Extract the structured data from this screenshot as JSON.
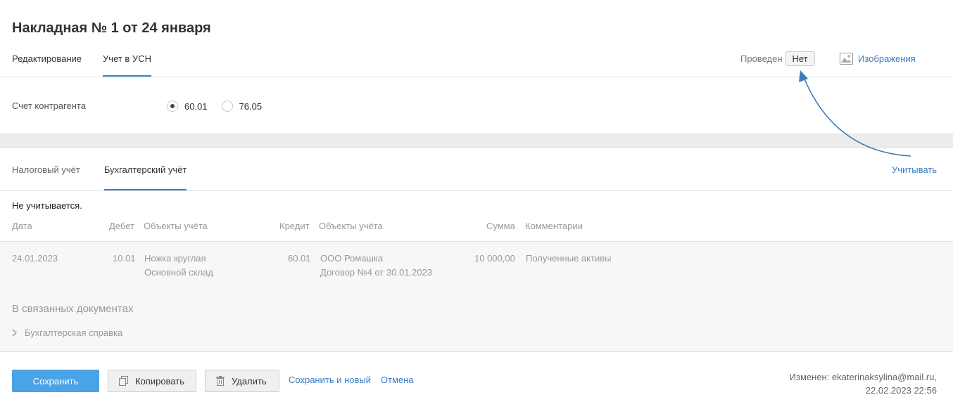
{
  "header": {
    "title": "Накладная № 1 от 24 января",
    "tabs": [
      {
        "label": "Редактирование",
        "active": false
      },
      {
        "label": "Учет в УСН",
        "active": true
      }
    ],
    "status_label": "Проведен",
    "status_value": "Нет",
    "images_link": "Изображения"
  },
  "account": {
    "label": "Счет контрагента",
    "options": [
      {
        "label": "60.01",
        "checked": true
      },
      {
        "label": "76.05",
        "checked": false
      }
    ]
  },
  "subtabs": [
    {
      "label": "Налоговый учёт",
      "active": false
    },
    {
      "label": "Бухгалтерский учёт",
      "active": true
    }
  ],
  "count_link": "Учитывать",
  "table": {
    "note": "Не учитывается.",
    "columns": {
      "date": "Дата",
      "debit": "Дебет",
      "debit_objects": "Объекты учёта",
      "credit": "Кредит",
      "credit_objects": "Объекты учёта",
      "sum": "Сумма",
      "comments": "Комментарии"
    },
    "rows": [
      {
        "date": "24.01.2023",
        "debit": "10.01",
        "debit_objects_1": "Ножка круглая",
        "debit_objects_2": "Основной склад",
        "credit": "60.01",
        "credit_objects_1": "ООО Ромашка",
        "credit_objects_2": "Договор №4 от 30.01.2023",
        "sum": "10 000,00",
        "comment": "Полученные активы"
      }
    ]
  },
  "related": {
    "title": "В связанных документах",
    "items": [
      "Бухгалтерская справка"
    ]
  },
  "footer": {
    "save": "Сохранить",
    "copy": "Копировать",
    "delete": "Удалить",
    "save_new": "Сохранить и новый",
    "cancel": "Отмена",
    "modified_line1": "Изменен: ekaterinaksylina@mail.ru,",
    "modified_line2": "22.02.2023 22:56"
  },
  "colors": {
    "accent": "#3a83c9",
    "link": "#3a7cc3",
    "primary_button": "#4aa3e6",
    "annotation_arrow": "#3f7ab8"
  }
}
